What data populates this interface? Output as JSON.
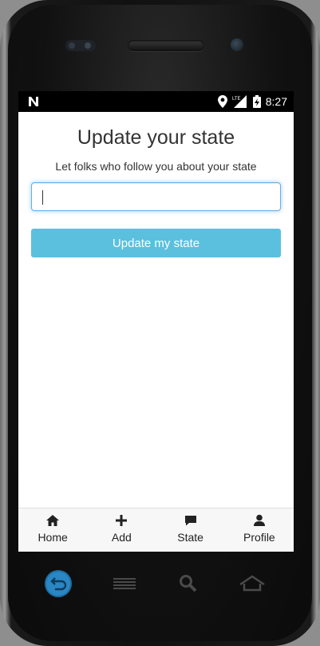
{
  "status_bar": {
    "time": "8:27",
    "network_label": "LTE"
  },
  "page": {
    "title": "Update your state",
    "subtitle": "Let folks who follow you about your state",
    "input": {
      "value": "",
      "placeholder": ""
    },
    "submit_label": "Update my state",
    "accent_color": "#5bc0de"
  },
  "tab_bar": {
    "tabs": [
      {
        "label": "Home",
        "icon": "home-icon"
      },
      {
        "label": "Add",
        "icon": "plus-icon"
      },
      {
        "label": "State",
        "icon": "comment-icon"
      },
      {
        "label": "Profile",
        "icon": "user-icon"
      }
    ]
  },
  "system_nav": {
    "buttons": [
      "back-icon",
      "menu-icon",
      "search-icon",
      "home-icon"
    ]
  }
}
